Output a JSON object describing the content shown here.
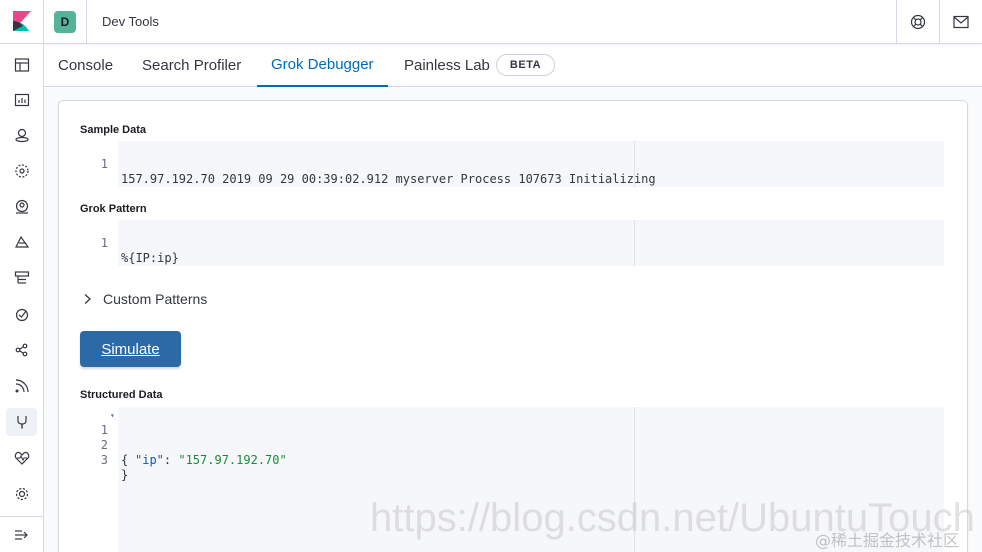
{
  "header": {
    "space_initial": "D",
    "app_title": "Dev Tools"
  },
  "tabs": [
    {
      "label": "Console"
    },
    {
      "label": "Search Profiler"
    },
    {
      "label": "Grok Debugger"
    },
    {
      "label": "Painless Lab"
    }
  ],
  "beta_badge": "BETA",
  "sample": {
    "label": "Sample Data",
    "lines": [
      {
        "num": "1",
        "text": "157.97.192.70 2019 09 29 00:39:02.912 myserver Process 107673 Initializing"
      }
    ]
  },
  "grok": {
    "label": "Grok Pattern",
    "lines": [
      {
        "num": "1",
        "text": "%{IP:ip}"
      }
    ]
  },
  "custom_patterns": "Custom Patterns",
  "simulate_label": "Simulate",
  "structured": {
    "label": "Structured Data",
    "lines": [
      {
        "num": "1",
        "text": "{"
      },
      {
        "num": "2",
        "key": "\"ip\"",
        "sep": ": ",
        "value": "\"157.97.192.70\""
      },
      {
        "num": "3",
        "text": "}"
      }
    ]
  },
  "watermark": "https://blog.csdn.net/UbuntuTouch",
  "watermark_cn": "@稀土掘金技术社区",
  "colors": {
    "accent": "#006bb4",
    "button": "#2b6aa6",
    "space_badge": "#54b399"
  },
  "icons": {
    "nav": [
      "overview-icon",
      "dashboard-icon",
      "maps-icon",
      "ml-icon",
      "user-icon",
      "siem-icon",
      "logs-icon",
      "uptime-icon",
      "graph-icon",
      "apm-icon",
      "dev-tools-icon",
      "monitoring-icon",
      "management-icon",
      "collapse-icon"
    ],
    "header": [
      "help-icon",
      "mail-icon"
    ]
  }
}
